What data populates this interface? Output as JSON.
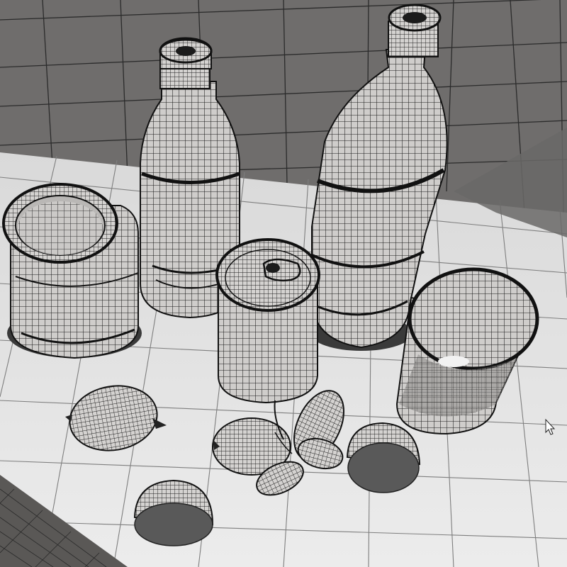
{
  "viewport": {
    "scene_objects": [
      {
        "name": "jar",
        "kind": "wireframe-mesh"
      },
      {
        "name": "small-bottle",
        "kind": "wireframe-mesh"
      },
      {
        "name": "large-bottle",
        "kind": "wireframe-mesh"
      },
      {
        "name": "soda-can",
        "kind": "wireframe-mesh"
      },
      {
        "name": "cup",
        "kind": "wireframe-mesh"
      },
      {
        "name": "lemon",
        "kind": "wireframe-mesh"
      },
      {
        "name": "lemon-half-left",
        "kind": "wireframe-mesh"
      },
      {
        "name": "lemon-half-right",
        "kind": "wireframe-mesh"
      },
      {
        "name": "lemon-with-leaves",
        "kind": "wireframe-mesh"
      }
    ],
    "cursor": {
      "icon": "arrow-cursor-icon"
    },
    "colors": {
      "wall": "#6f6d6c",
      "floor": "#e6e6e6",
      "wire": "#1a1a1a",
      "shade": "#4a4a4a"
    }
  }
}
